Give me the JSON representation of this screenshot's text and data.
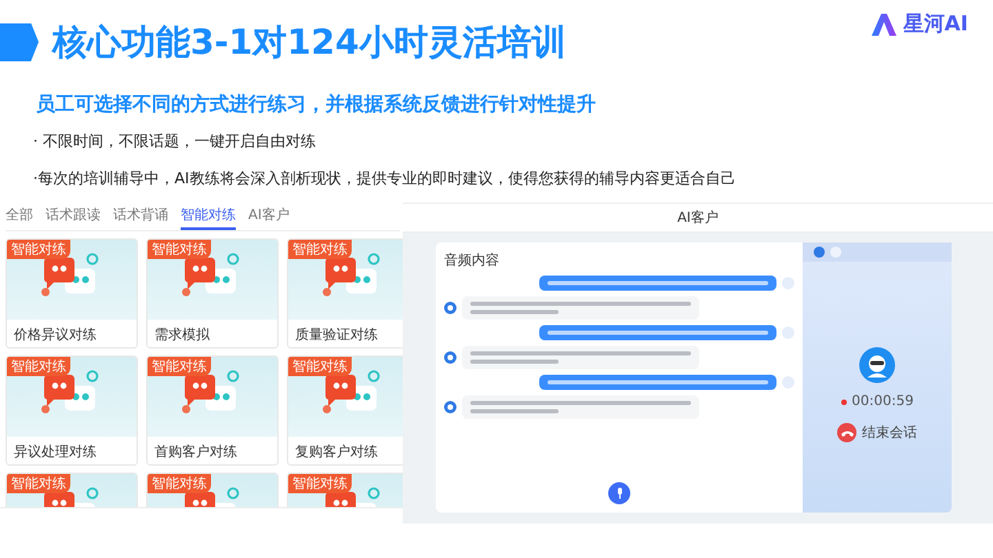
{
  "header": {
    "title": "核心功能3-1对124小时灵活培训",
    "logo": "星河AI"
  },
  "subtitle": "员工可选择不同的方式进行练习，并根据系统反馈进行针对性提升",
  "bullets": [
    "· 不限时间，不限话题，一键开启自由对练",
    "·每次的培训辅导中，AI教练将会深入剖析现状，提供专业的即时建议，使得您获得的辅导内容更适合自己"
  ],
  "practice_app": {
    "tabs": [
      {
        "label": "全部",
        "selected": false
      },
      {
        "label": "话术跟读",
        "selected": false
      },
      {
        "label": "话术背诵",
        "selected": false
      },
      {
        "label": "智能对练",
        "selected": true
      },
      {
        "label": "AI客户",
        "selected": false
      }
    ],
    "cards": [
      {
        "badge": "智能对练",
        "title": "价格异议对练"
      },
      {
        "badge": "智能对练",
        "title": "需求模拟"
      },
      {
        "badge": "智能对练",
        "title": "质量验证对练"
      },
      {
        "badge": "智能对练",
        "title": "异议处理对练"
      },
      {
        "badge": "智能对练",
        "title": "首购客户对练"
      },
      {
        "badge": "智能对练",
        "title": "复购客户对练"
      },
      {
        "badge": "智能对练"
      },
      {
        "badge": "智能对练"
      },
      {
        "badge": "智能对练"
      }
    ]
  },
  "ai_client": {
    "title": "AI客户",
    "transcript_label": "音频内容",
    "messages": [
      {
        "kind": "sent"
      },
      {
        "kind": "received"
      },
      {
        "kind": "sent"
      },
      {
        "kind": "received"
      },
      {
        "kind": "sent"
      },
      {
        "kind": "received"
      }
    ],
    "timer": "00:00:59",
    "end_call": "结束会话"
  }
}
